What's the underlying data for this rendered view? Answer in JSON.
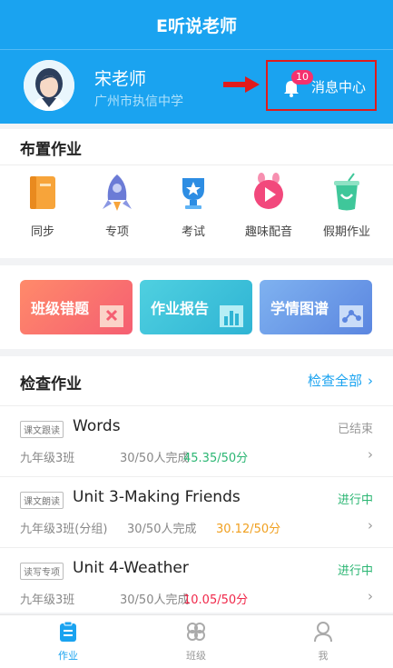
{
  "app_title": "E听说老师",
  "profile": {
    "name": "宋老师",
    "school": "广州市执信中学",
    "avatar_icon": "teacher-avatar"
  },
  "messages": {
    "label": "消息中心",
    "badge": "10",
    "icon": "bell-icon"
  },
  "assign": {
    "title": "布置作业",
    "items": [
      {
        "label": "同步",
        "icon": "book-icon",
        "color": "#f7a43a"
      },
      {
        "label": "专项",
        "icon": "rocket-icon",
        "color": "#6b7bd6"
      },
      {
        "label": "考试",
        "icon": "trophy-icon",
        "color": "#2d8de3"
      },
      {
        "label": "趣味配音",
        "icon": "play-icon",
        "color": "#f2487c"
      },
      {
        "label": "假期作业",
        "icon": "drink-icon",
        "color": "#3fc79a"
      }
    ]
  },
  "tiles": [
    {
      "label": "班级错题",
      "icon": "wrong-answers-icon",
      "color": "#f76d6d"
    },
    {
      "label": "作业报告",
      "icon": "report-chart-icon",
      "color": "#3cc3d8"
    },
    {
      "label": "学情图谱",
      "icon": "graph-icon",
      "color": "#6a9ae8"
    }
  ],
  "check": {
    "title": "检查作业",
    "view_all": "检查全部",
    "items": [
      {
        "tag": "课文跟读",
        "title": "Words",
        "status": "已结束",
        "status_color": "#999999",
        "class": "九年级3班",
        "done": "30/50人完成",
        "score": "45.35/50分",
        "score_color": "#2bb673"
      },
      {
        "tag": "课文朗读",
        "title": "Unit 3-Making Friends",
        "status": "进行中",
        "status_color": "#2bb673",
        "class": "九年级3班(分组)",
        "done": "30/50人完成",
        "score": "30.12/50分",
        "score_color": "#f0a020"
      },
      {
        "tag": "读写专项",
        "title": "Unit 4-Weather",
        "status": "进行中",
        "status_color": "#2bb673",
        "class": "九年级3班",
        "done": "30/50人完成",
        "score": "10.05/50分",
        "score_color": "#f0284a"
      }
    ]
  },
  "tabs": [
    {
      "label": "作业",
      "icon": "homework-icon",
      "active": true
    },
    {
      "label": "班级",
      "icon": "class-icon",
      "active": false
    },
    {
      "label": "我",
      "icon": "profile-icon",
      "active": false
    }
  ],
  "colors": {
    "brand": "#1aa3f0",
    "highlight_box": "#e01b1b",
    "badge": "#f5316e"
  }
}
